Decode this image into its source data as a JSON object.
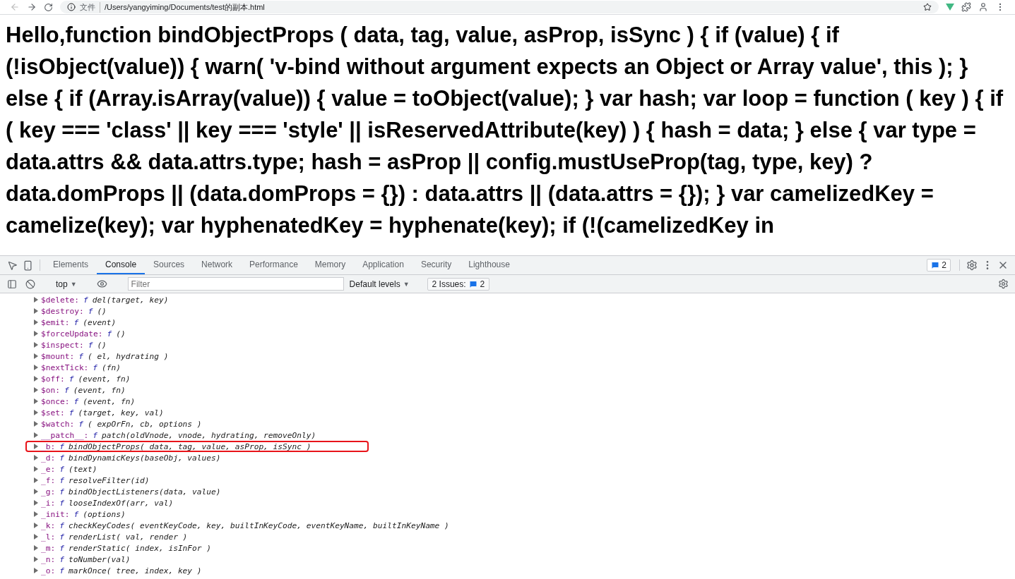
{
  "browser": {
    "address_prefix": "文件",
    "url": "/Users/yangyiming/Documents/test的副本.html"
  },
  "page": {
    "text": "Hello,function bindObjectProps ( data, tag, value, asProp, isSync ) { if (value) { if (!isObject(value)) { warn( 'v-bind without argument expects an Object or Array value', this ); } else { if (Array.isArray(value)) { value = toObject(value); } var hash; var loop = function ( key ) { if ( key === 'class' || key === 'style' || isReservedAttribute(key) ) { hash = data; } else { var type = data.attrs && data.attrs.type; hash = asProp || config.mustUseProp(tag, type, key) ? data.domProps || (data.domProps = {}) : data.attrs || (data.attrs = {}); } var camelizedKey = camelize(key); var hyphenatedKey = hyphenate(key); if (!(camelizedKey in"
  },
  "devtools": {
    "tabs": [
      {
        "label": "Elements",
        "selected": false
      },
      {
        "label": "Console",
        "selected": true
      },
      {
        "label": "Sources",
        "selected": false
      },
      {
        "label": "Network",
        "selected": false
      },
      {
        "label": "Performance",
        "selected": false
      },
      {
        "label": "Memory",
        "selected": false
      },
      {
        "label": "Application",
        "selected": false
      },
      {
        "label": "Security",
        "selected": false
      },
      {
        "label": "Lighthouse",
        "selected": false
      }
    ],
    "issues_badge": "2",
    "toolbar": {
      "context": "top",
      "context_caret": "▼",
      "filter_placeholder": "Filter",
      "levels": "Default levels",
      "levels_caret": "▼",
      "issues_label": "2 Issues:",
      "issues_count": "2"
    },
    "console_lines": [
      {
        "name": "$delete:",
        "fn": "f",
        "signature": "del(target, key)",
        "highlighted": false
      },
      {
        "name": "$destroy:",
        "fn": "f",
        "signature": "()",
        "highlighted": false
      },
      {
        "name": "$emit:",
        "fn": "f",
        "signature": "(event)",
        "highlighted": false
      },
      {
        "name": "$forceUpdate:",
        "fn": "f",
        "signature": "()",
        "highlighted": false
      },
      {
        "name": "$inspect:",
        "fn": "f",
        "signature": "()",
        "highlighted": false
      },
      {
        "name": "$mount:",
        "fn": "f",
        "signature": "( el, hydrating )",
        "highlighted": false
      },
      {
        "name": "$nextTick:",
        "fn": "f",
        "signature": "(fn)",
        "highlighted": false
      },
      {
        "name": "$off:",
        "fn": "f",
        "signature": "(event, fn)",
        "highlighted": false
      },
      {
        "name": "$on:",
        "fn": "f",
        "signature": "(event, fn)",
        "highlighted": false
      },
      {
        "name": "$once:",
        "fn": "f",
        "signature": "(event, fn)",
        "highlighted": false
      },
      {
        "name": "$set:",
        "fn": "f",
        "signature": "(target, key, val)",
        "highlighted": false
      },
      {
        "name": "$watch:",
        "fn": "f",
        "signature": "( expOrFn, cb, options )",
        "highlighted": false
      },
      {
        "name": "__patch__:",
        "fn": "f",
        "signature": "patch(oldVnode, vnode, hydrating, removeOnly)",
        "highlighted": false
      },
      {
        "name": "_b:",
        "fn": "f",
        "signature": "bindObjectProps( data, tag, value, asProp, isSync )",
        "highlighted": true
      },
      {
        "name": "_d:",
        "fn": "f",
        "signature": "bindDynamicKeys(baseObj, values)",
        "highlighted": false
      },
      {
        "name": "_e:",
        "fn": "f",
        "signature": "(text)",
        "highlighted": false
      },
      {
        "name": "_f:",
        "fn": "f",
        "signature": "resolveFilter(id)",
        "highlighted": false
      },
      {
        "name": "_g:",
        "fn": "f",
        "signature": "bindObjectListeners(data, value)",
        "highlighted": false
      },
      {
        "name": "_i:",
        "fn": "f",
        "signature": "looseIndexOf(arr, val)",
        "highlighted": false
      },
      {
        "name": "_init:",
        "fn": "f",
        "signature": "(options)",
        "highlighted": false
      },
      {
        "name": "_k:",
        "fn": "f",
        "signature": "checkKeyCodes( eventKeyCode, key, builtInKeyCode, eventKeyName, builtInKeyName )",
        "highlighted": false
      },
      {
        "name": "_l:",
        "fn": "f",
        "signature": "renderList( val, render )",
        "highlighted": false
      },
      {
        "name": "_m:",
        "fn": "f",
        "signature": "renderStatic( index, isInFor )",
        "highlighted": false
      },
      {
        "name": "_n:",
        "fn": "f",
        "signature": "toNumber(val)",
        "highlighted": false
      },
      {
        "name": "_o:",
        "fn": "f",
        "signature": "markOnce( tree, index, key )",
        "highlighted": false
      }
    ]
  }
}
